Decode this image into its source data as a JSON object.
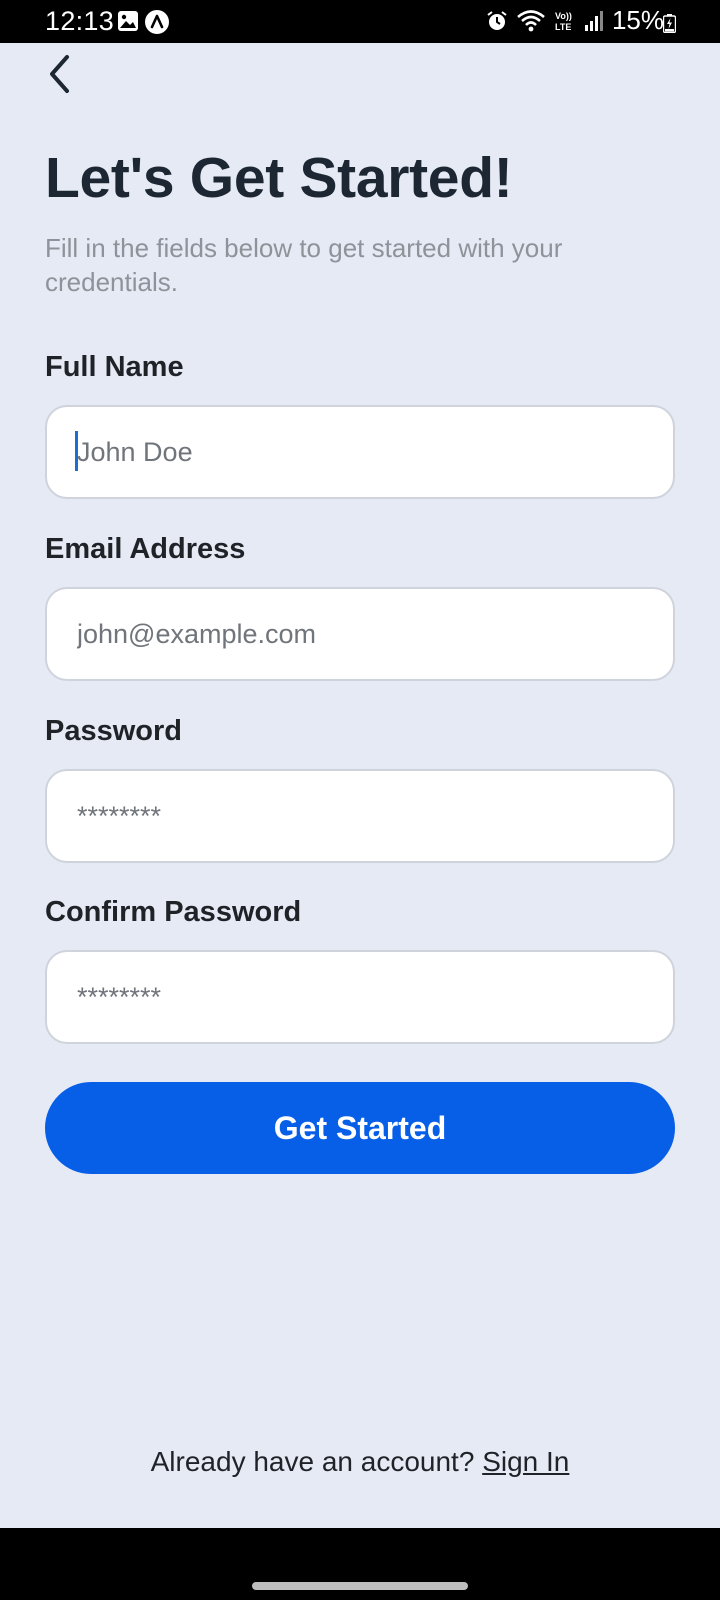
{
  "status_bar": {
    "time": "12:13",
    "battery_percent": "15%",
    "icons": [
      "gallery-icon",
      "a-icon",
      "alarm-icon",
      "wifi-icon",
      "volte-icon",
      "signal-icon",
      "battery-icon"
    ]
  },
  "header": {
    "back_icon": "chevron-left-icon",
    "title": "Let's Get Started!",
    "subtitle": "Fill in the fields below to get started with your credentials."
  },
  "form": {
    "full_name": {
      "label": "Full Name",
      "placeholder": "John Doe",
      "value": ""
    },
    "email": {
      "label": "Email Address",
      "placeholder": "john@example.com",
      "value": ""
    },
    "password": {
      "label": "Password",
      "placeholder": "********",
      "value": ""
    },
    "confirm_password": {
      "label": "Confirm Password",
      "placeholder": "********",
      "value": ""
    },
    "submit_label": "Get Started"
  },
  "footer": {
    "prompt": "Already have an account?",
    "link_label": "Sign In"
  },
  "colors": {
    "background": "#e6eaf4",
    "accent": "#075fe8",
    "title_text": "#1d2733",
    "subtitle_text": "#8e9399"
  }
}
